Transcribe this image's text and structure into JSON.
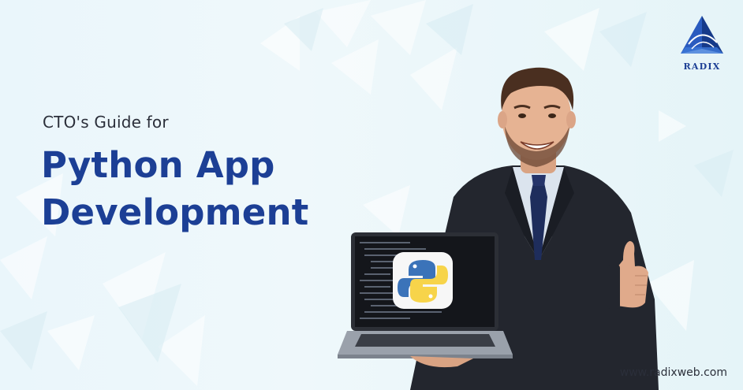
{
  "banner": {
    "subtitle": "CTO's Guide for",
    "title_line1": "Python App",
    "title_line2": "Development",
    "website": "www.radixweb.com"
  },
  "logo": {
    "name": "RADIX",
    "icon": "radix-pyramid-logo"
  },
  "colors": {
    "headline": "#1c3f95",
    "background": "#eaf6fb",
    "suit": "#23262e",
    "python_blue": "#3b73b9",
    "python_yellow": "#f7d44a"
  },
  "illustration": {
    "person": "smiling-man-in-suit",
    "gesture": "thumbs-up",
    "device": "laptop-with-python-logo"
  }
}
